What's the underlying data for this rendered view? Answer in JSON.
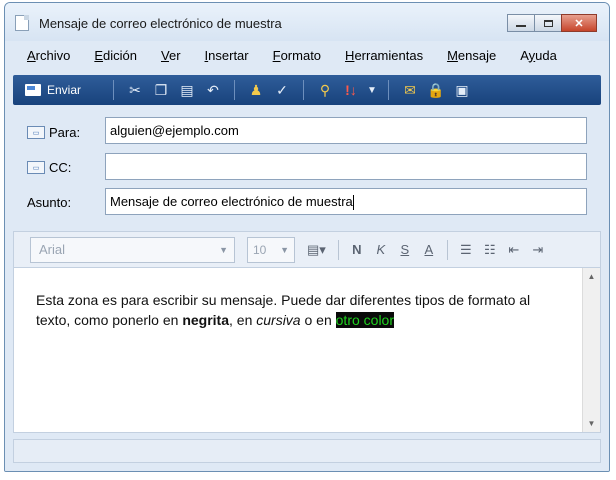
{
  "window": {
    "title": "Mensaje de correo electrónico de muestra"
  },
  "menu": [
    "Archivo",
    "Edición",
    "Ver",
    "Insertar",
    "Formato",
    "Herramientas",
    "Mensaje",
    "Ayuda"
  ],
  "menu_accel": [
    "A",
    "E",
    "V",
    "I",
    "F",
    "H",
    "M",
    "y"
  ],
  "toolbar": {
    "send_label": "Enviar",
    "icons": [
      "cut-icon",
      "copy-icon",
      "paste-icon",
      "undo-icon",
      "check-names-icon",
      "spelling-icon",
      "attach-icon",
      "priority-icon",
      "sign-icon",
      "encrypt-icon",
      "offline-icon"
    ]
  },
  "header": {
    "to_label": "Para:",
    "to_value": "alguien@ejemplo.com",
    "cc_label": "CC:",
    "cc_value": "",
    "subject_label": "Asunto:",
    "subject_value": "Mensaje de correo electrónico de muestra"
  },
  "format": {
    "font": "Arial",
    "size": "10",
    "bold": "N",
    "italic": "K",
    "underline": "S",
    "font_color": "A"
  },
  "body": {
    "text_1": "Esta zona es para escribir su mensaje. Puede dar diferentes tipos de formato al texto, como ponerlo en ",
    "bold": "negrita",
    "text_2": ", en ",
    "italic": "cursiva",
    "text_3": " o en ",
    "highlight": "otro color",
    "highlight_color": "#1fd11f",
    "highlight_background": "#0a0a0a"
  },
  "colors": {
    "toolbar_bg": "#1f4b87",
    "window_bg": "#dfe9f5",
    "close_button": "#c6452b"
  }
}
